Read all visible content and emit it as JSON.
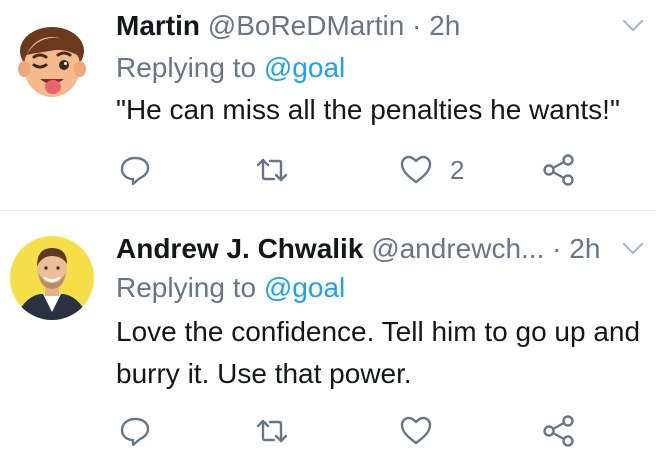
{
  "tweets": [
    {
      "author_name": "Martin",
      "author_handle": "@BoReDMartin",
      "separator": "·",
      "time": "2h",
      "replying_prefix": "Replying to",
      "replying_to": "@goal",
      "text": "\"He can miss all the penalties he wants!\"",
      "like_count": "2",
      "avatar_icon": "memoji-winking-tongue-out",
      "avatar_bg": "#ffffff"
    },
    {
      "author_name": "Andrew J. Chwalik",
      "author_handle": "@andrewch...",
      "separator": "·",
      "time": "2h",
      "replying_prefix": "Replying to",
      "replying_to": "@goal",
      "text": "Love the confidence. Tell him to go up and burry it. Use that power.",
      "like_count": "",
      "avatar_icon": "photo-man-in-suit",
      "avatar_bg": "#f5e04a"
    }
  ],
  "icons": {
    "reply": "reply-icon",
    "retweet": "retweet-icon",
    "like": "heart-icon",
    "share": "share-icon",
    "menu": "chevron-down-icon"
  },
  "colors": {
    "text": "#14171a",
    "secondary": "#657786",
    "accent": "#1da1f2",
    "divider": "#e1e8ed"
  }
}
